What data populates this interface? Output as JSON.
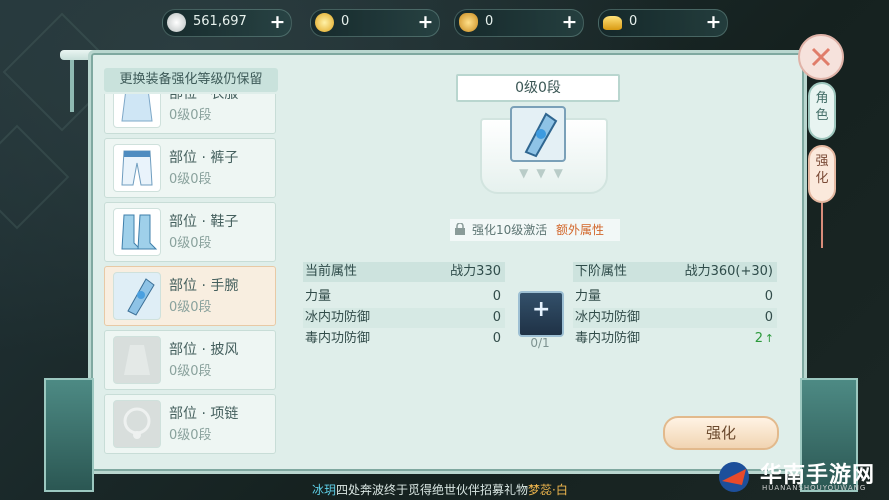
{
  "currencies": [
    {
      "icon": "silver-coin-icon",
      "value": "561,697",
      "color": "#d8dcdc"
    },
    {
      "icon": "gold-coin-icon",
      "value": "0",
      "color": "#f1c232"
    },
    {
      "icon": "treasure-bowl-icon",
      "value": "0",
      "color": "#e5a83b"
    },
    {
      "icon": "gold-ingot-icon",
      "value": "0",
      "color": "#f0b429"
    }
  ],
  "list": {
    "title": "更换装备强化等级仍保留",
    "items": [
      {
        "name": "部位 · 衣服",
        "level": "0级0段",
        "icon": "robe-icon",
        "selected": false
      },
      {
        "name": "部位 · 裤子",
        "level": "0级0段",
        "icon": "pants-icon",
        "selected": false
      },
      {
        "name": "部位 · 鞋子",
        "level": "0级0段",
        "icon": "boots-icon",
        "selected": false
      },
      {
        "name": "部位 · 手腕",
        "level": "0级0段",
        "icon": "bracer-icon",
        "selected": true
      },
      {
        "name": "部位 · 披风",
        "level": "0级0段",
        "icon": "cape-icon",
        "selected": false
      },
      {
        "name": "部位 · 项链",
        "level": "0级0段",
        "icon": "necklace-icon",
        "selected": false
      }
    ]
  },
  "detail": {
    "level_banner": "0级0段",
    "unlock_prefix": "强化10级激活",
    "unlock_highlight": "额外属性",
    "current": {
      "title": "当前属性",
      "power": "战力330",
      "rows": [
        {
          "label": "力量",
          "value": "0"
        },
        {
          "label": "冰内功防御",
          "value": "0"
        },
        {
          "label": "毒内功防御",
          "value": "0"
        }
      ]
    },
    "next": {
      "title": "下阶属性",
      "power": "战力360(+30)",
      "rows": [
        {
          "label": "力量",
          "value": "0"
        },
        {
          "label": "冰内功防御",
          "value": "0"
        },
        {
          "label": "毒内功防御",
          "value": "2"
        }
      ]
    },
    "material_count": "0/1",
    "enhance_button": "强化"
  },
  "side_tabs": {
    "role": "角色",
    "enhance": "强化"
  },
  "bottom_ticker": {
    "part1": "冰玥",
    "part2": "四处奔波终于觅得绝世伙伴招募礼物",
    "part3": "梦蕊·白"
  },
  "watermark": {
    "main": "华南手游网",
    "sub": "HUANANSHOUYOUWANG"
  }
}
